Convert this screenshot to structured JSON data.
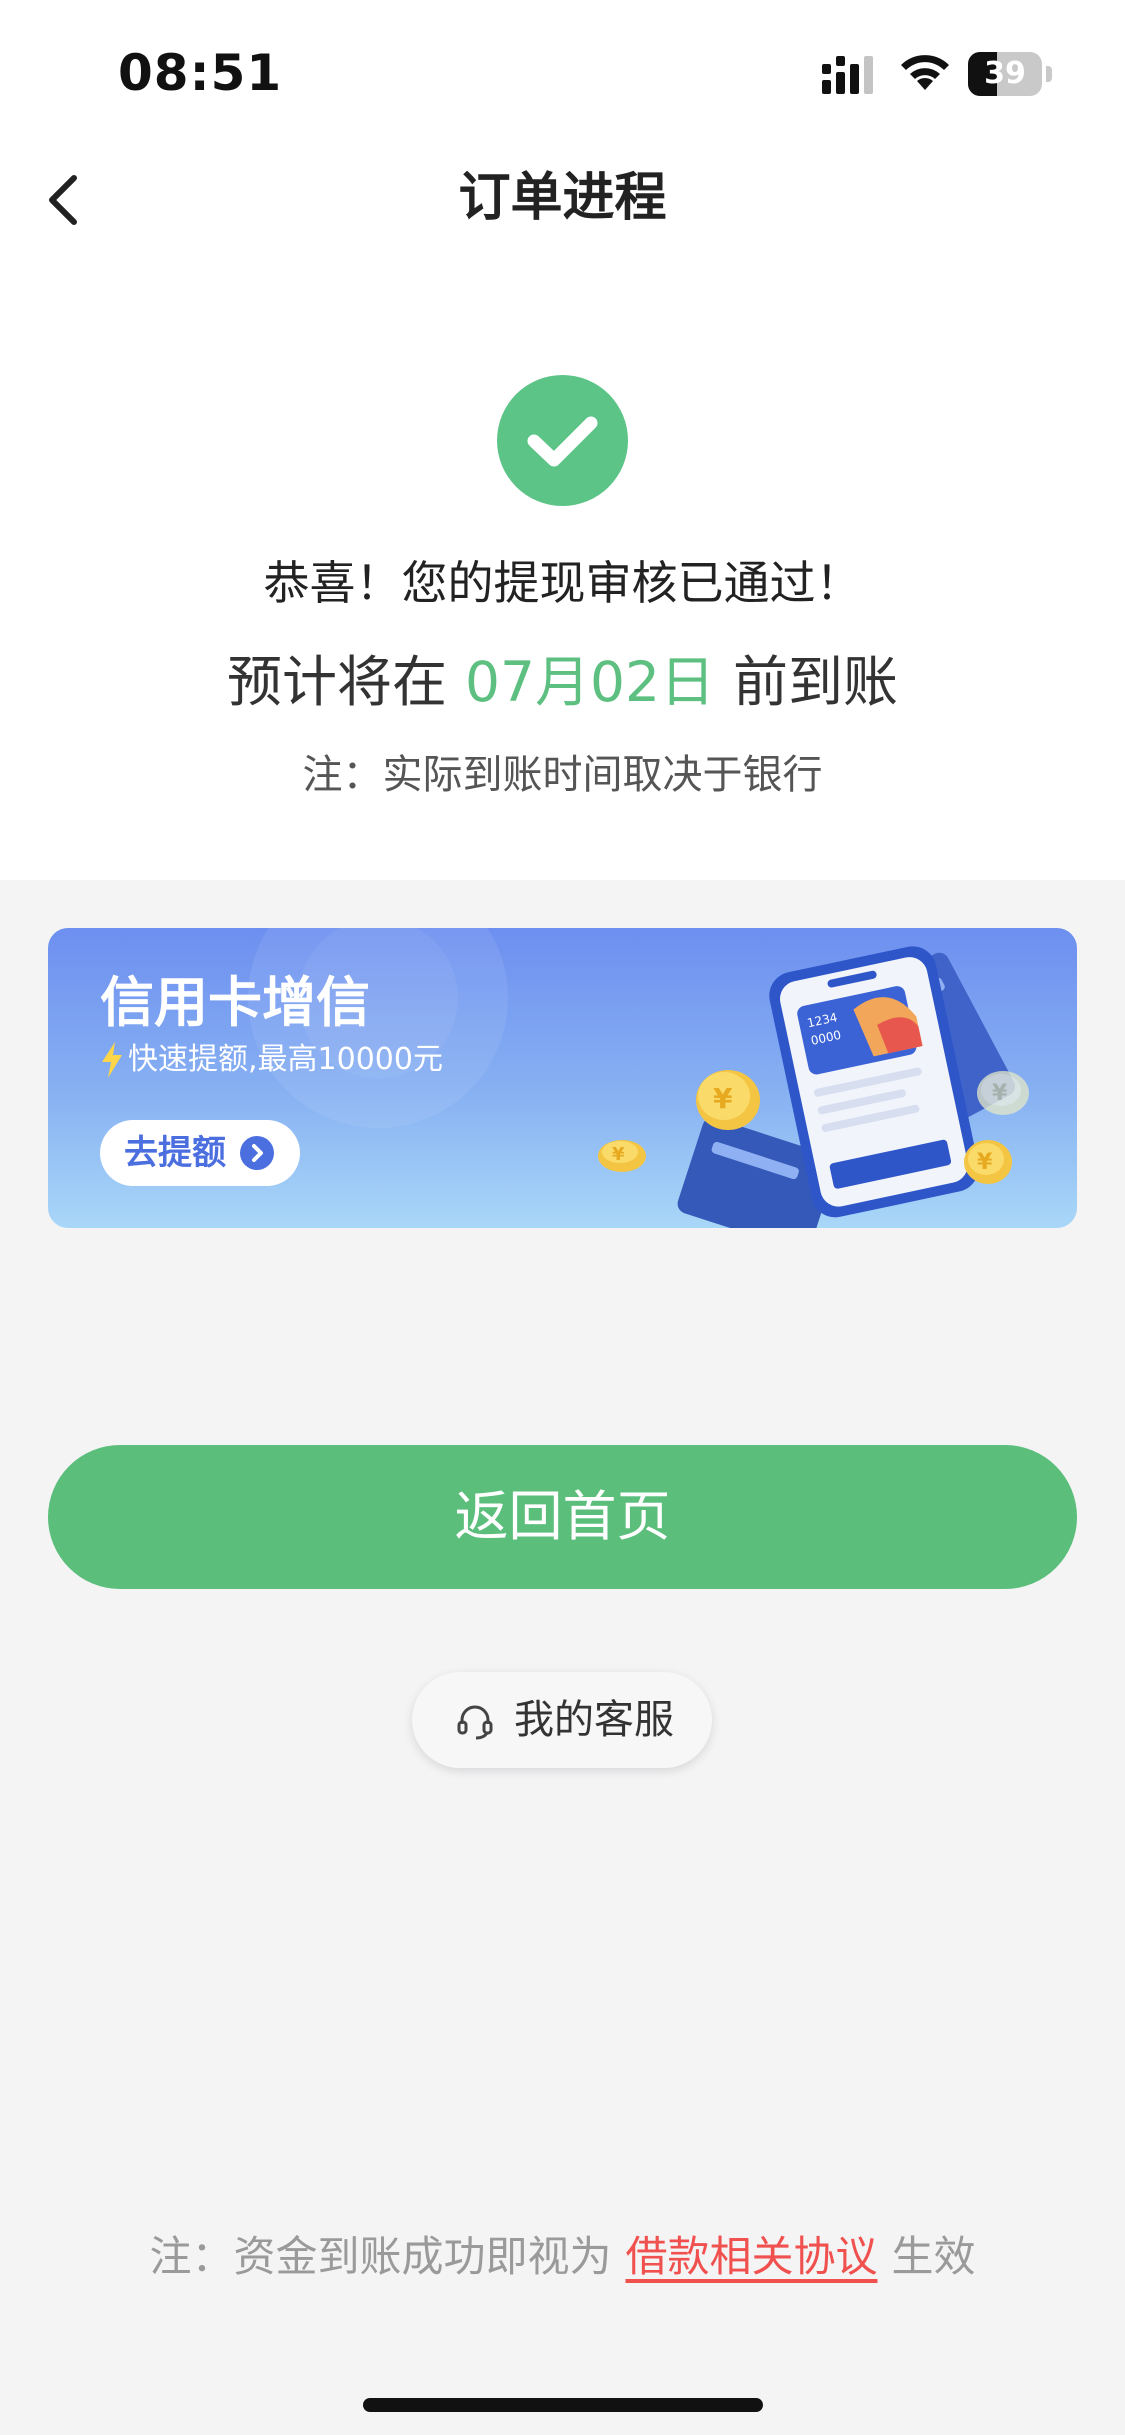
{
  "status_bar": {
    "time": "08:51",
    "battery": "39",
    "battery_level": 0.39
  },
  "nav": {
    "title": "订单进程"
  },
  "result": {
    "title": "恭喜！您的提现审核已通过！",
    "arrival_prefix": "预计将在",
    "arrival_date": "07月02日",
    "arrival_suffix": "前到账",
    "bank_note": "注：实际到账时间取决于银行"
  },
  "banner": {
    "title": "信用卡增信",
    "subtitle": "快速提额,最高10000元",
    "button_label": "去提额",
    "card_number": "1234",
    "card_sub": "0000"
  },
  "actions": {
    "home_button": "返回首页",
    "service_button": "我的客服"
  },
  "footer": {
    "note_prefix": "注：资金到账成功即视为",
    "agreement_link": "借款相关协议",
    "note_suffix": "生效"
  },
  "colors": {
    "primary_green": "#5bbe7b",
    "link_red": "#f0514f",
    "banner_blue": "#6d8ff0"
  },
  "icons": {
    "back": "chevron-left-icon",
    "success": "check-circle-icon",
    "service": "headset-icon",
    "banner_button": "chevron-right-circle-icon",
    "bolt": "lightning-icon"
  }
}
